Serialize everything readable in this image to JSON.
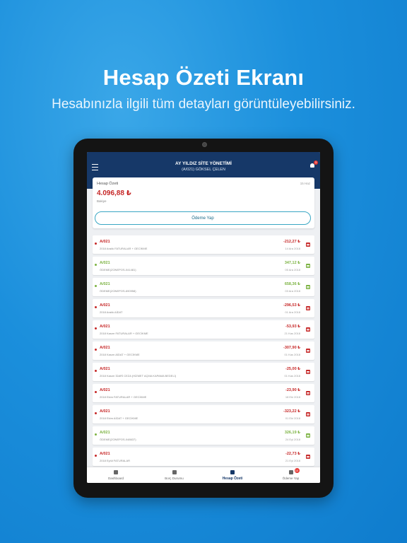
{
  "promo": {
    "headline": "Hesap Özeti Ekranı",
    "subline": "Hesabınızla ilgili tüm detayları görüntüleyebilirsiniz."
  },
  "app": {
    "title": "AY YILDIZ SİTE YÖNETİMİ",
    "subtitle": "(A/021) GÖKSEL ÇELEN",
    "notification_count": "3"
  },
  "summary": {
    "label": "Hesap Özeti",
    "date": "15 Haz",
    "amount": "4.096,88 ₺",
    "caption": "Bakiye",
    "pay_button": "Ödeme Yap"
  },
  "colors": {
    "debit": "#c62828",
    "credit": "#7cb342",
    "navy": "#163868"
  },
  "transactions": [
    {
      "code": "A/021",
      "desc": "2018 Aralık FATURALAR + GECİKME",
      "amount": "-212,27 ₺",
      "date": "14 Ara 2018",
      "type": "debit"
    },
    {
      "code": "A/021",
      "desc": "ÖDEME(ZONEPOS-041481)",
      "amount": "347,12 ₺",
      "date": "05 Ara 2018",
      "type": "credit"
    },
    {
      "code": "A/021",
      "desc": "ÖDEME(ZONEPOS-690958)",
      "amount": "658,36 ₺",
      "date": "03 Ara 2018",
      "type": "credit"
    },
    {
      "code": "A/021",
      "desc": "2018 Aralık AİDAT",
      "amount": "-296,53 ₺",
      "date": "01 Ara 2018",
      "type": "debit"
    },
    {
      "code": "A/021",
      "desc": "2018 Kasım FATURALAR + GECİKME",
      "amount": "-53,93 ₺",
      "date": "21 Kas 2018",
      "type": "debit"
    },
    {
      "code": "A/021",
      "desc": "2018 Kasım AİDAT + GECİKME",
      "amount": "-307,90 ₺",
      "date": "01 Kas 2018",
      "type": "debit"
    },
    {
      "code": "A/021",
      "desc": "2018 Kasım İDARİ CEZA (HİZMET AÇMA KAPAMA BEDELİ)",
      "amount": "-25,00 ₺",
      "date": "01 Kas 2018",
      "type": "debit"
    },
    {
      "code": "A/021",
      "desc": "2018 Ekim FATURALAR + GECİKME",
      "amount": "-23,90 ₺",
      "date": "18 Eki 2018",
      "type": "debit"
    },
    {
      "code": "A/021",
      "desc": "2018 Ekim AİDAT + GECİKME",
      "amount": "-323,22 ₺",
      "date": "01 Eki 2018",
      "type": "debit"
    },
    {
      "code": "A/021",
      "desc": "ÖDEME(ZONEPOS-048637)",
      "amount": "326,19 ₺",
      "date": "24 Eyl 2018",
      "type": "credit"
    },
    {
      "code": "A/021",
      "desc": "2018 Eylül FATURALAR",
      "amount": "-22,73 ₺",
      "date": "21 Eyl 2018",
      "type": "debit"
    }
  ],
  "nav": [
    {
      "label": "Dashboard",
      "icon": "dashboard-icon",
      "active": false,
      "badge": ""
    },
    {
      "label": "Borç Durumu",
      "icon": "debt-icon",
      "active": false,
      "badge": ""
    },
    {
      "label": "Hesap Özeti",
      "icon": "statement-icon",
      "active": true,
      "badge": ""
    },
    {
      "label": "Ödeme Yap",
      "icon": "payment-icon",
      "active": false,
      "badge": "10"
    }
  ]
}
